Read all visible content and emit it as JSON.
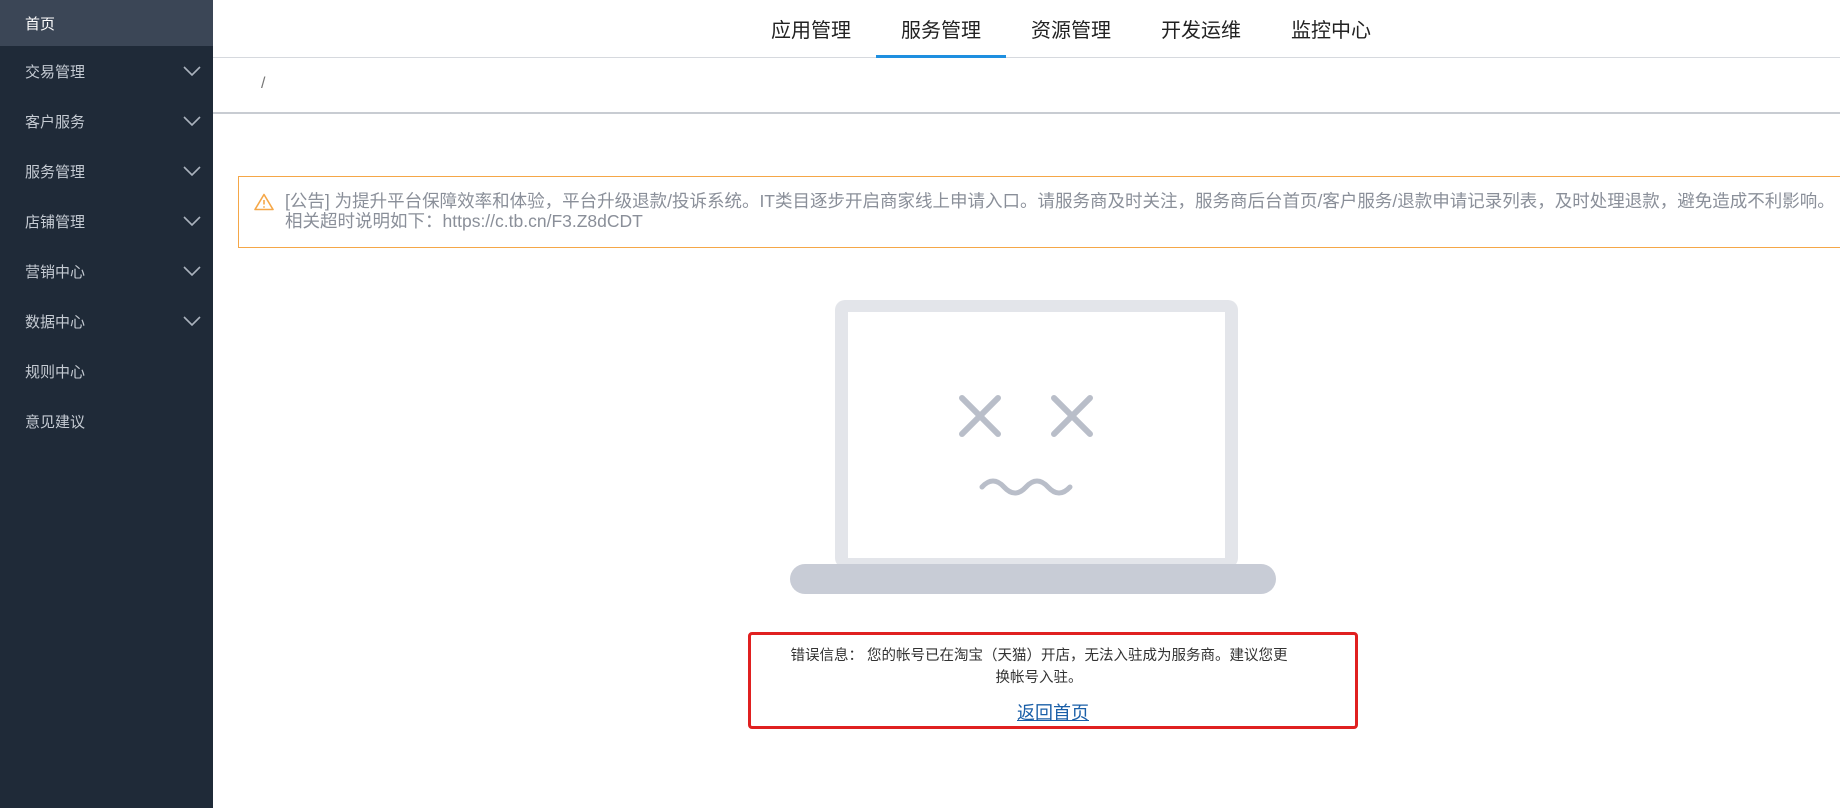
{
  "sidebar": {
    "items": [
      {
        "label": "首页",
        "active": true,
        "expandable": false
      },
      {
        "label": "交易管理",
        "expandable": true
      },
      {
        "label": "客户服务",
        "expandable": true
      },
      {
        "label": "服务管理",
        "expandable": true
      },
      {
        "label": "店铺管理",
        "expandable": true
      },
      {
        "label": "营销中心",
        "expandable": true
      },
      {
        "label": "数据中心",
        "expandable": true
      },
      {
        "label": "规则中心",
        "expandable": false
      },
      {
        "label": "意见建议",
        "expandable": false
      }
    ]
  },
  "topnav": {
    "tabs": [
      {
        "label": "应用管理"
      },
      {
        "label": "服务管理",
        "active": true
      },
      {
        "label": "资源管理"
      },
      {
        "label": "开发运维"
      },
      {
        "label": "监控中心"
      }
    ]
  },
  "breadcrumb": {
    "separator": "/"
  },
  "notice": {
    "text": "[公告] 为提升平台保障效率和体验，平台升级退款/投诉系统。IT类目逐步开启商家线上申请入口。请服务商及时关注，服务商后台首页/客户服务/退款申请记录列表，及时处理退款，避免造成不利影响。相关超时说明如下：https://c.tb.cn/F3.Z8dCDT",
    "icon": "warning-icon",
    "border_color": "#f5a748"
  },
  "error": {
    "message": "错误信息： 您的帐号已在淘宝（天猫）开店，无法入驻成为服务商。建议您更换帐号入驻。",
    "back_label": "返回首页",
    "border_color": "#e02020"
  },
  "colors": {
    "sidebar_bg": "#1f2a38",
    "accent": "#1e8fe0",
    "link": "#1a5fa8"
  }
}
